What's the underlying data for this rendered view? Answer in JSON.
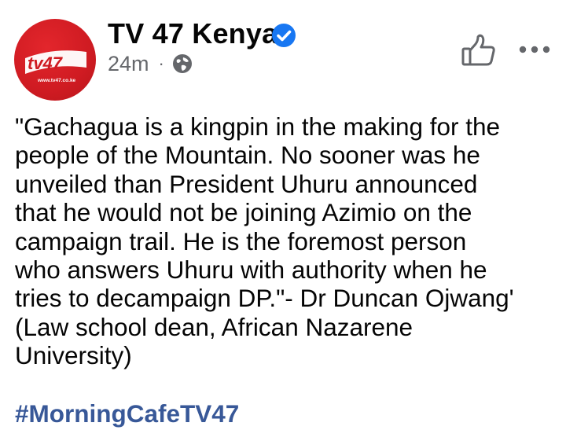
{
  "page": {
    "author_name": "TV 47 Kenya",
    "timestamp": "24m",
    "separator": "·",
    "audience_icon": "globe-icon",
    "verified_icon": "verified-badge-icon",
    "like_icon": "thumbs-up-icon",
    "more_icon": "more-options-icon"
  },
  "avatar": {
    "logo_text": "tv47",
    "url_text": "www.tv47.co.ke",
    "brand_color": "#cf1b22"
  },
  "post": {
    "lines": [
      "\"Gachagua is a kingpin in the making for the",
      "people of the Mountain. No sooner was he",
      "unveiled than President Uhuru announced",
      "that he would not be joining Azimio on the",
      "campaign trail. He is the foremost person",
      "who answers Uhuru with authority when he",
      "tries to decampaign DP.\"- Dr Duncan Ojwang'",
      "(Law school dean, African Nazarene",
      "University)"
    ],
    "hashtag": "#MorningCafeTV47"
  },
  "colors": {
    "text": "#050505",
    "secondary_text": "#65676b",
    "hashtag": "#385898",
    "verified": "#1877f2"
  }
}
